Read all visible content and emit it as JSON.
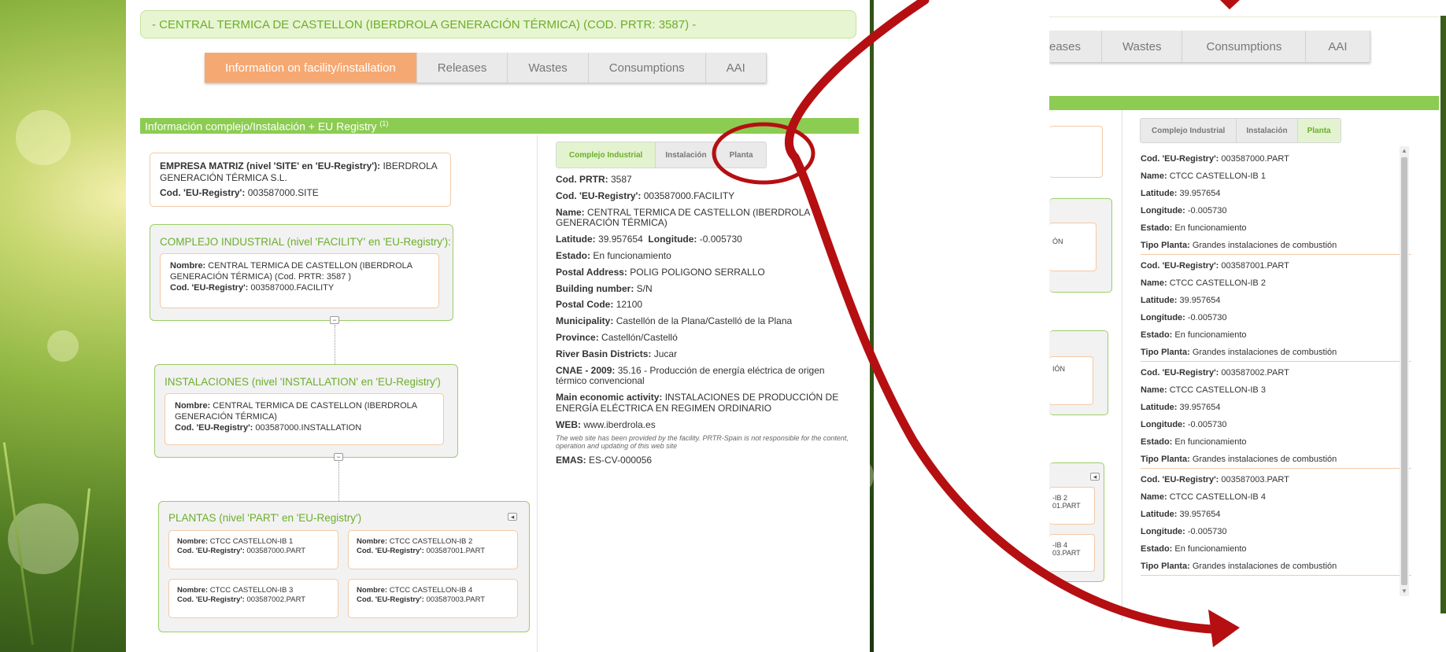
{
  "header": {
    "title": "- CENTRAL TERMICA DE CASTELLON (IBERDROLA GENERACIÓN TÉRMICA) (COD. PRTR: 3587) -"
  },
  "main_tabs": [
    {
      "label": "Information on facility/installation",
      "active": true
    },
    {
      "label": "Releases",
      "active": false
    },
    {
      "label": "Wastes",
      "active": false
    },
    {
      "label": "Consumptions",
      "active": false
    },
    {
      "label": "AAI",
      "active": false
    }
  ],
  "section": {
    "title": "Información complejo/Instalación + EU Registry",
    "sup": "(1)"
  },
  "hierarchy": {
    "site": {
      "label_bold": "EMPRESA MATRIZ (nivel 'SITE' en 'EU-Registry'):",
      "name": "IBERDROLA GENERACIÓN TÉRMICA S.L.",
      "code_label": "Cod. 'EU-Registry':",
      "code": "003587000.SITE"
    },
    "facility": {
      "title": "COMPLEJO INDUSTRIAL (nivel 'FACILITY' en 'EU-Registry'):",
      "name_label": "Nombre:",
      "name": "CENTRAL TERMICA DE CASTELLON (IBERDROLA GENERACIÓN TÉRMICA) (Cod. PRTR: 3587 )",
      "code_label": "Cod. 'EU-Registry':",
      "code": "003587000.FACILITY"
    },
    "installation": {
      "title": "INSTALACIONES (nivel 'INSTALLATION' en 'EU-Registry')",
      "name_label": "Nombre:",
      "name": "CENTRAL TERMICA DE CASTELLON (IBERDROLA GENERACIÓN TÉRMICA)",
      "code_label": "Cod. 'EU-Registry':",
      "code": "003587000.INSTALLATION"
    },
    "plants": {
      "title": "PLANTAS (nivel 'PART' en 'EU-Registry')",
      "items": [
        {
          "name_label": "Nombre:",
          "name": "CTCC CASTELLON-IB 1",
          "code_label": "Cod. 'EU-Registry':",
          "code": "003587000.PART"
        },
        {
          "name_label": "Nombre:",
          "name": "CTCC CASTELLON-IB 2",
          "code_label": "Cod. 'EU-Registry':",
          "code": "003587001.PART"
        },
        {
          "name_label": "Nombre:",
          "name": "CTCC CASTELLON-IB 3",
          "code_label": "Cod. 'EU-Registry':",
          "code": "003587002.PART"
        },
        {
          "name_label": "Nombre:",
          "name": "CTCC CASTELLON-IB 4",
          "code_label": "Cod. 'EU-Registry':",
          "code": "003587003.PART"
        }
      ]
    },
    "collapse_glyph": "−",
    "toggle_glyph": "◂"
  },
  "detail_tabs": [
    {
      "label": "Complejo Industrial",
      "active": true
    },
    {
      "label": "Instalación",
      "active": false
    },
    {
      "label": "Planta",
      "active": false
    }
  ],
  "facility_info": [
    {
      "label": "Cod. PRTR:",
      "value": "3587"
    },
    {
      "label": "Cod. 'EU-Registry':",
      "value": "003587000.FACILITY"
    },
    {
      "label": "Name:",
      "value": "CENTRAL TERMICA DE CASTELLON (IBERDROLA GENERACIÓN TÉRMICA)"
    },
    {
      "label": "Latitude:",
      "value": "39.957654",
      "label2": "Longitude:",
      "value2": "-0.005730"
    },
    {
      "label": "Estado:",
      "value": "En funcionamiento"
    },
    {
      "label": "Postal Address:",
      "value": "POLIG POLIGONO SERRALLO"
    },
    {
      "label": "Building number:",
      "value": "S/N"
    },
    {
      "label": "Postal Code:",
      "value": "12100"
    },
    {
      "label": "Municipality:",
      "value": "Castellón de la Plana/Castelló de la Plana"
    },
    {
      "label": "Province:",
      "value": "Castellón/Castelló"
    },
    {
      "label": "River Basin Districts:",
      "value": "Jucar"
    },
    {
      "label": "CNAE - 2009:",
      "value": "35.16 - Producción de energía eléctrica de origen térmico convencional"
    },
    {
      "label": "Main economic activity:",
      "value": "INSTALACIONES DE PRODUCCIÓN DE ENERGÍA ELÉCTRICA EN REGIMEN ORDINARIO"
    },
    {
      "label": "WEB:",
      "value": "www.iberdrola.es"
    }
  ],
  "web_note": "The web site has been provided by the facility. PRTR-Spain is not responsible for the content, operation and updating of this web site",
  "emas": {
    "label": "EMAS:",
    "value": "ES-CV-000056"
  },
  "right_view": {
    "tabs": [
      {
        "label": "eases"
      },
      {
        "label": "Wastes"
      },
      {
        "label": "Consumptions"
      },
      {
        "label": "AAI"
      }
    ],
    "detail_tabs": [
      {
        "label": "Complejo Industrial",
        "active": false
      },
      {
        "label": "Instalación",
        "active": false
      },
      {
        "label": "Planta",
        "active": true
      }
    ],
    "fragments": [
      "ÓN",
      "IÓN",
      "-IB 2",
      "01.PART",
      "-IB 4",
      "03.PART"
    ],
    "plants": [
      {
        "code_label": "Cod. 'EU-Registry':",
        "code": "003587000.PART",
        "name_label": "Name:",
        "name": "CTCC CASTELLON-IB 1",
        "lat_label": "Latitude:",
        "lat": "39.957654",
        "lon_label": "Longitude:",
        "lon": "-0.005730",
        "estado_label": "Estado:",
        "estado": "En funcionamiento",
        "tipo_label": "Tipo Planta:",
        "tipo": "Grandes instalaciones de combustión"
      },
      {
        "code_label": "Cod. 'EU-Registry':",
        "code": "003587001.PART",
        "name_label": "Name:",
        "name": "CTCC CASTELLON-IB 2",
        "lat_label": "Latitude:",
        "lat": "39.957654",
        "lon_label": "Longitude:",
        "lon": "-0.005730",
        "estado_label": "Estado:",
        "estado": "En funcionamiento",
        "tipo_label": "Tipo Planta:",
        "tipo": "Grandes instalaciones de combustión"
      },
      {
        "code_label": "Cod. 'EU-Registry':",
        "code": "003587002.PART",
        "name_label": "Name:",
        "name": "CTCC CASTELLON-IB 3",
        "lat_label": "Latitude:",
        "lat": "39.957654",
        "lon_label": "Longitude:",
        "lon": "-0.005730",
        "estado_label": "Estado:",
        "estado": "En funcionamiento",
        "tipo_label": "Tipo Planta:",
        "tipo": "Grandes instalaciones de combustión"
      },
      {
        "code_label": "Cod. 'EU-Registry':",
        "code": "003587003.PART",
        "name_label": "Name:",
        "name": "CTCC CASTELLON-IB 4",
        "lat_label": "Latitude:",
        "lat": "39.957654",
        "lon_label": "Longitude:",
        "lon": "-0.005730",
        "estado_label": "Estado:",
        "estado": "En funcionamiento",
        "tipo_label": "Tipo Planta:",
        "tipo": "Grandes instalaciones de combustión"
      }
    ],
    "scroll_up": "▲",
    "scroll_down": "▼"
  },
  "colors": {
    "accent_green": "#6cae2b",
    "section_green": "#8ccc52",
    "active_tab_orange": "#f5a872",
    "card_border": "#f3c9a6",
    "annotation_red": "#b50f12"
  }
}
